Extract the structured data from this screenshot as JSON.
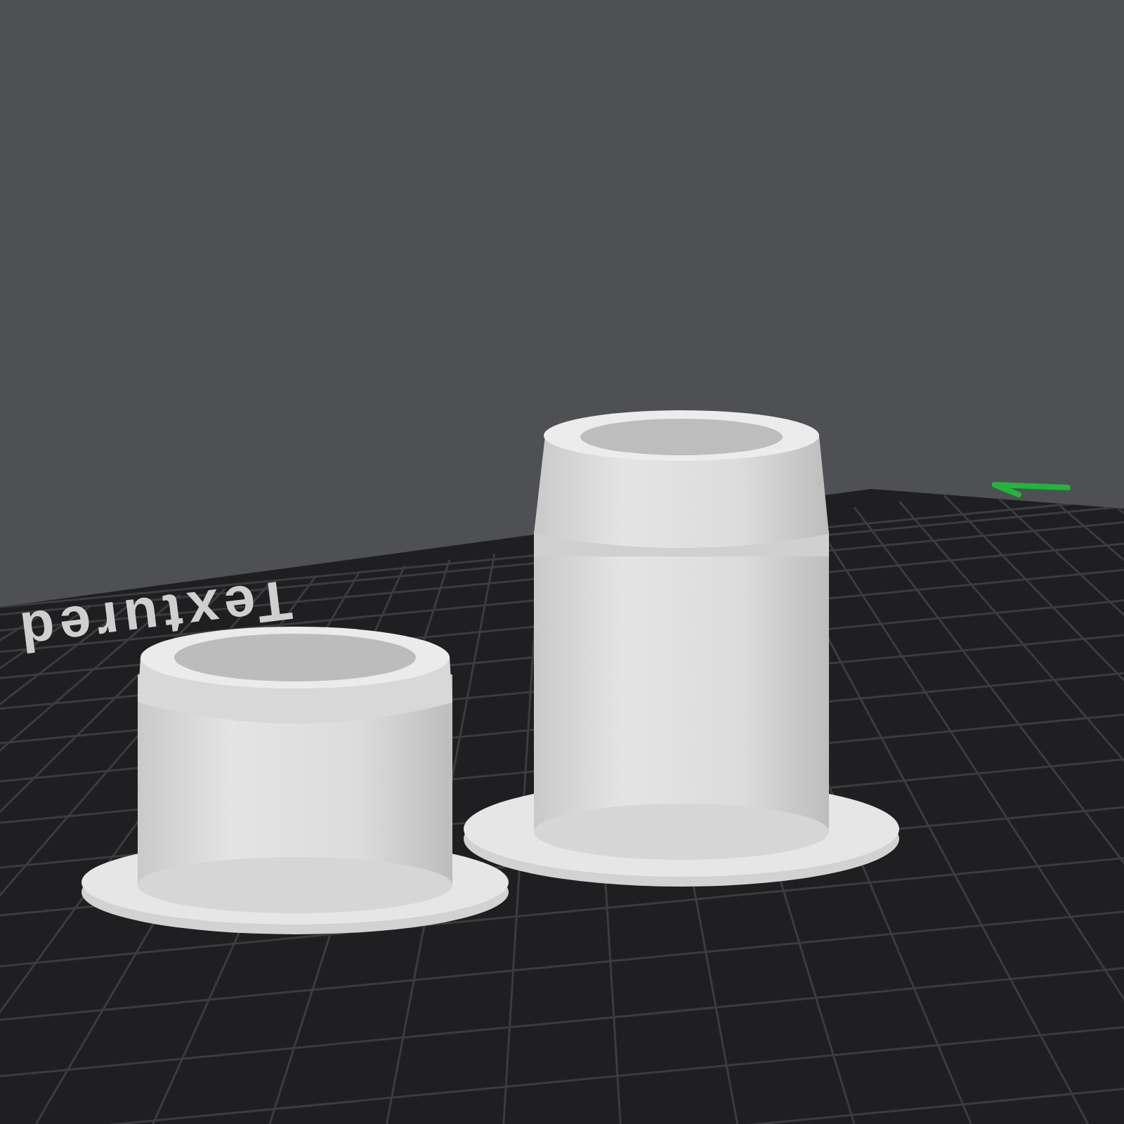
{
  "viewport": {
    "bed_label": "Textured"
  }
}
